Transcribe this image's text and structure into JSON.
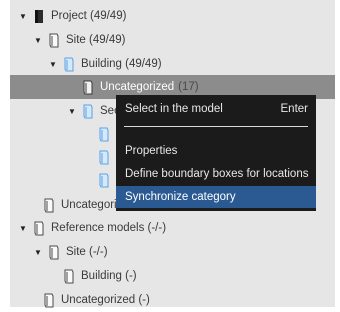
{
  "tree": {
    "project_label": "Project (49/49)",
    "site_label": "Site (49/49)",
    "building_label": "Building (49/49)",
    "uncategorized_label": "Uncategorized",
    "uncategorized_count": "(17)",
    "section_label_partial": "Sec",
    "uncategorized2_label": "Uncategoriz",
    "reference_label": "Reference models (-/-)",
    "ref_site_label": "Site (-/-)",
    "ref_building_label": "Building (-)",
    "ref_uncategorized_label": "Uncategorized (-)"
  },
  "context_menu": {
    "items": [
      {
        "label": "Select in the model",
        "shortcut": "Enter"
      },
      {
        "label": "Properties"
      },
      {
        "label": "Define boundary boxes for locations"
      },
      {
        "label": "Synchronize category"
      }
    ],
    "selected_index": 3
  },
  "colors": {
    "panel_bg": "#e6e6e6",
    "row_highlight": "#8c8c8c",
    "menu_bg": "#1b1b1b",
    "menu_selected": "#2b5a93",
    "icon_blue": "#5aa0e6",
    "icon_outline": "#4a4a4a"
  },
  "icons": [
    "project-icon",
    "folder-outline-icon",
    "folder-blue-icon",
    "item-blue-icon"
  ]
}
